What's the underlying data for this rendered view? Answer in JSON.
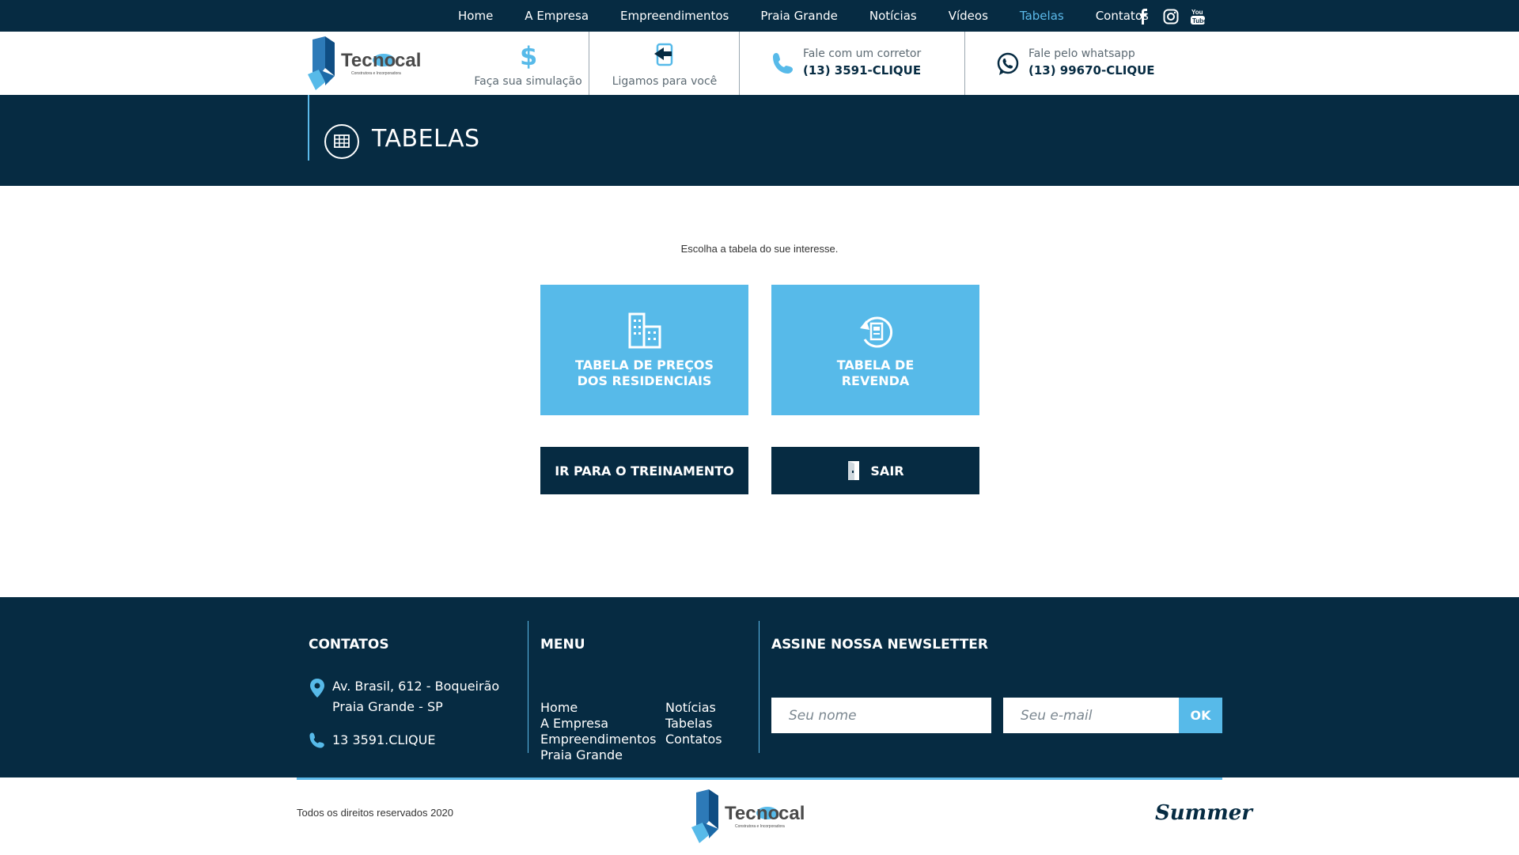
{
  "nav": {
    "items": [
      {
        "label": "Home",
        "active": false
      },
      {
        "label": "A Empresa",
        "active": false
      },
      {
        "label": "Empreendimentos",
        "active": false
      },
      {
        "label": "Praia Grande",
        "active": false
      },
      {
        "label": "Notícias",
        "active": false
      },
      {
        "label": "Vídeos",
        "active": false
      },
      {
        "label": "Tabelas",
        "active": true
      },
      {
        "label": "Contatos",
        "active": false
      }
    ],
    "social": [
      "facebook-icon",
      "instagram-icon",
      "youtube-icon"
    ]
  },
  "header": {
    "logo_text": "Tecnocal",
    "logo_sub": "Construtora e Incorporadora",
    "simulacao_label": "Faça sua simulação",
    "ligamos_label": "Ligamos para você",
    "phone_label": "Fale com um corretor",
    "phone_number": "(13) 3591-CLIQUE",
    "whats_label": "Fale pelo whatsapp",
    "whats_number": "(13) 99670-CLIQUE"
  },
  "banner": {
    "title": "TABELAS"
  },
  "main": {
    "intro": "Escolha a tabela do sue interesse.",
    "card1_line1": "TABELA DE PREÇOS",
    "card1_line2": "DOS RESIDENCIAIS",
    "card2_line1": "TABELA DE",
    "card2_line2": "REVENDA",
    "btn_treinamento": "IR PARA O TREINAMENTO",
    "btn_sair": "SAIR"
  },
  "footer": {
    "contatos_title": "CONTATOS",
    "address_line1": "Av. Brasil, 612 - Boqueirão",
    "address_line2": "Praia Grande - SP",
    "phone": "13 3591.CLIQUE",
    "menu_title": "MENU",
    "menu_col1": [
      "Home",
      "A Empresa",
      "Empreendimentos",
      "Praia Grande"
    ],
    "menu_col2": [
      "Notícias",
      "Tabelas",
      "Contatos"
    ],
    "newsletter_title": "ASSINE NOSSA NEWSLETTER",
    "name_placeholder": "Seu nome",
    "email_placeholder": "Seu e-mail",
    "ok_label": "OK"
  },
  "bottom": {
    "copyright": "Todos os direitos reservados 2020",
    "agency": "Summer"
  },
  "colors": {
    "navy": "#062b42",
    "accent": "#57bae9"
  }
}
